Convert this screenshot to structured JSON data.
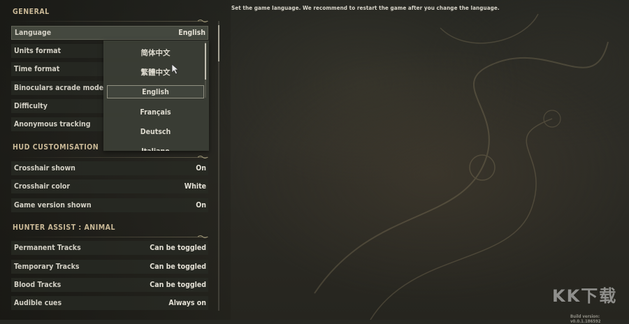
{
  "hint": "Set the game language. We recommend to restart the game after you change the language.",
  "sections": {
    "general": {
      "title": "GENERAL",
      "rows": [
        {
          "label": "Language",
          "value": "English"
        },
        {
          "label": "Units format",
          "value": ""
        },
        {
          "label": "Time format",
          "value": ""
        },
        {
          "label": "Binoculars acrade mode",
          "value": ""
        },
        {
          "label": "Difficulty",
          "value": ""
        },
        {
          "label": "Anonymous tracking",
          "value": ""
        }
      ]
    },
    "hud": {
      "title": "HUD CUSTOMISATION",
      "rows": [
        {
          "label": "Crosshair shown",
          "value": "On"
        },
        {
          "label": "Crosshair color",
          "value": "White"
        },
        {
          "label": "Game version shown",
          "value": "On"
        }
      ]
    },
    "hunter_assist": {
      "title": "HUNTER ASSIST : ANIMAL",
      "rows": [
        {
          "label": "Permanent Tracks",
          "value": "Can be toggled"
        },
        {
          "label": "Temporary Tracks",
          "value": "Can be toggled"
        },
        {
          "label": "Blood Tracks",
          "value": "Can be toggled"
        },
        {
          "label": "Audible cues",
          "value": "Always on"
        }
      ]
    }
  },
  "language_dropdown": {
    "options": [
      "简体中文",
      "繁體中文",
      "English",
      "Français",
      "Deutsch",
      "Italiano"
    ],
    "selected": "English"
  },
  "build_version": "Build version: v0.0.1.186592",
  "watermark": "KK下载",
  "icons": [
    "ornament-icon",
    "mouse-cursor-icon"
  ],
  "colors": {
    "section_title": "#c9b896",
    "row_bg": "#282a24",
    "dropdown_bg": "#3a3d35"
  }
}
